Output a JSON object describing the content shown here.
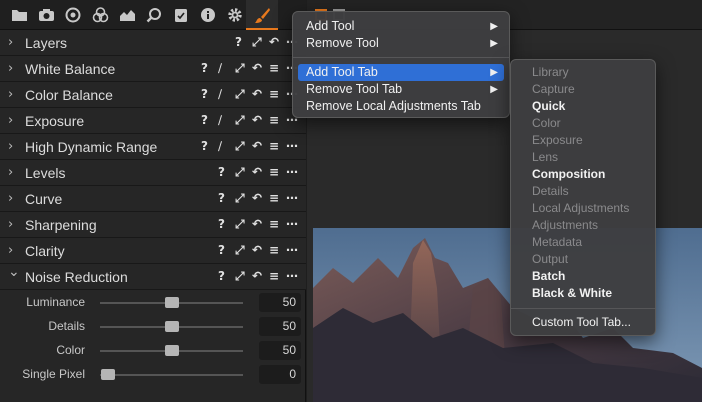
{
  "toolbar": {
    "icons": [
      "folder-icon",
      "camera-icon",
      "color-icon",
      "color-balance-icon",
      "exposure-icon",
      "search-icon",
      "checklist-icon",
      "info-icon",
      "gear-icon",
      "brush-icon"
    ],
    "accent": "#e8791d"
  },
  "tools": [
    {
      "name": "Layers",
      "expanded": false
    },
    {
      "name": "White Balance",
      "expanded": false
    },
    {
      "name": "Color Balance",
      "expanded": false
    },
    {
      "name": "Exposure",
      "expanded": false
    },
    {
      "name": "High Dynamic Range",
      "expanded": false
    },
    {
      "name": "Levels",
      "expanded": false
    },
    {
      "name": "Curve",
      "expanded": false
    },
    {
      "name": "Sharpening",
      "expanded": false
    },
    {
      "name": "Clarity",
      "expanded": false
    },
    {
      "name": "Noise Reduction",
      "expanded": true
    }
  ],
  "tool_icons": {
    "help": "?",
    "more": "⋯"
  },
  "noise_reduction": {
    "sliders": [
      {
        "label": "Luminance",
        "value": "50",
        "fraction": 0.5
      },
      {
        "label": "Details",
        "value": "50",
        "fraction": 0.5
      },
      {
        "label": "Color",
        "value": "50",
        "fraction": 0.5
      },
      {
        "label": "Single Pixel",
        "value": "0",
        "fraction": 0.0
      }
    ]
  },
  "context_menu": {
    "items": [
      {
        "label": "Add Tool",
        "submenu": true
      },
      {
        "label": "Remove Tool",
        "submenu": true
      },
      {
        "label": "Add Tool Tab",
        "submenu": true,
        "selected": true
      },
      {
        "label": "Remove Tool Tab",
        "submenu": true
      },
      {
        "label": "Remove Local Adjustments Tab",
        "submenu": false
      }
    ],
    "highlight_color": "#2f6fd6"
  },
  "submenu": {
    "items": [
      {
        "label": "Library",
        "enabled": false
      },
      {
        "label": "Capture",
        "enabled": false
      },
      {
        "label": "Quick",
        "enabled": true
      },
      {
        "label": "Color",
        "enabled": false
      },
      {
        "label": "Exposure",
        "enabled": false
      },
      {
        "label": "Lens",
        "enabled": false
      },
      {
        "label": "Composition",
        "enabled": true
      },
      {
        "label": "Details",
        "enabled": false
      },
      {
        "label": "Local Adjustments",
        "enabled": false
      },
      {
        "label": "Adjustments",
        "enabled": false
      },
      {
        "label": "Metadata",
        "enabled": false
      },
      {
        "label": "Output",
        "enabled": false
      },
      {
        "label": "Batch",
        "enabled": true
      },
      {
        "label": "Black & White",
        "enabled": true
      }
    ],
    "custom_label": "Custom Tool Tab..."
  }
}
